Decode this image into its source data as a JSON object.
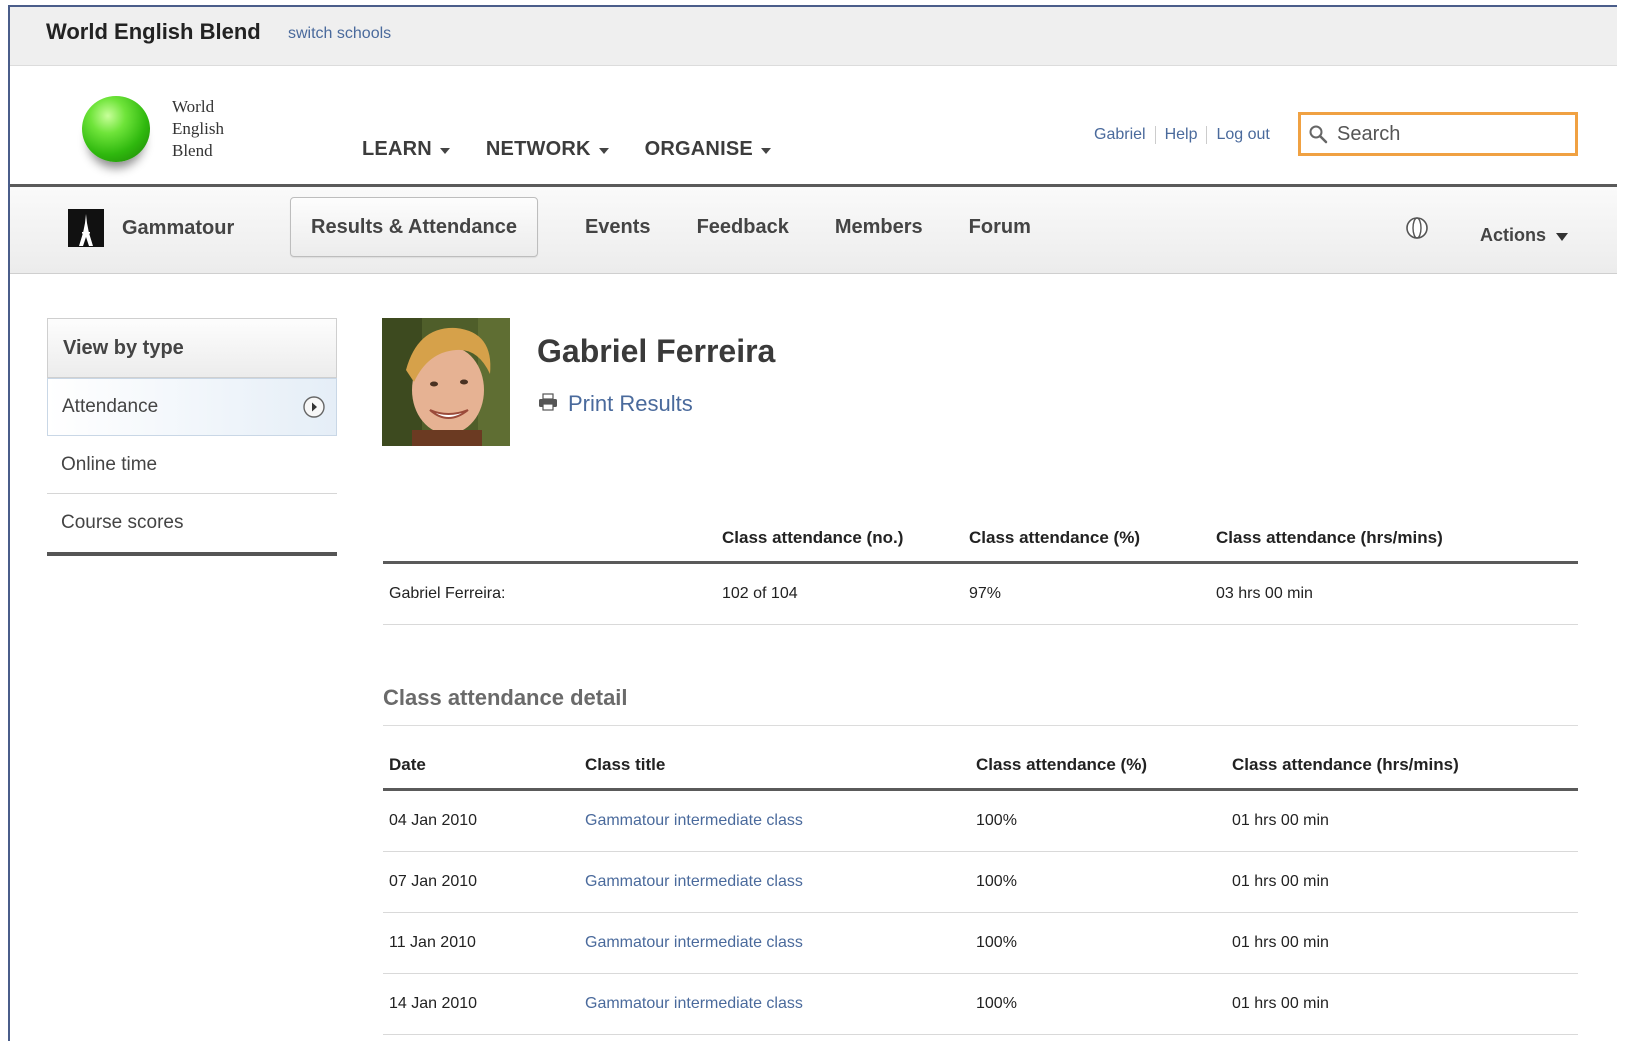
{
  "school_bar": {
    "school_name": "World English Blend",
    "switch_label": "switch schools"
  },
  "header": {
    "logo_lines": [
      "World",
      "English",
      "Blend"
    ],
    "main_nav": [
      {
        "label": "LEARN"
      },
      {
        "label": "NETWORK"
      },
      {
        "label": "ORGANISE"
      }
    ],
    "user_links": [
      "Gabriel",
      "Help",
      "Log out"
    ],
    "search": {
      "placeholder": "Search",
      "value": ""
    },
    "accent_color": "#f0a142"
  },
  "group_bar": {
    "group_name": "Gammatour",
    "tabs": [
      "Results & Attendance",
      "Events",
      "Feedback",
      "Members",
      "Forum"
    ],
    "active_tab": "Results & Attendance",
    "actions_label": "Actions"
  },
  "sidebar": {
    "heading": "View by type",
    "items": [
      "Attendance",
      "Online time",
      "Course scores"
    ],
    "active_item": "Attendance"
  },
  "profile": {
    "name": "Gabriel Ferreira",
    "print_label": "Print Results"
  },
  "summary": {
    "headers": [
      "",
      "Class attendance (no.)",
      "Class attendance (%)",
      "Class attendance (hrs/mins)"
    ],
    "row": {
      "name": "Gabriel Ferreira:",
      "attendance_no": "102 of 104",
      "attendance_pct": "97%",
      "attendance_time": "03 hrs 00 min"
    }
  },
  "detail": {
    "title": "Class attendance detail",
    "headers": [
      "Date",
      "Class title",
      "Class attendance (%)",
      "Class attendance (hrs/mins)"
    ],
    "rows": [
      {
        "date": "04 Jan 2010",
        "class_title": "Gammatour intermediate class",
        "pct": "100%",
        "time": "01 hrs 00 min"
      },
      {
        "date": "07 Jan 2010",
        "class_title": "Gammatour intermediate class",
        "pct": "100%",
        "time": "01 hrs 00 min"
      },
      {
        "date": "11 Jan 2010",
        "class_title": "Gammatour intermediate class",
        "pct": "100%",
        "time": "01 hrs 00 min"
      },
      {
        "date": "14 Jan 2010",
        "class_title": "Gammatour intermediate class",
        "pct": "100%",
        "time": "01 hrs 00 min"
      }
    ]
  },
  "colors": {
    "link": "#4a6a9c",
    "logo_green": "#2fb80e"
  }
}
